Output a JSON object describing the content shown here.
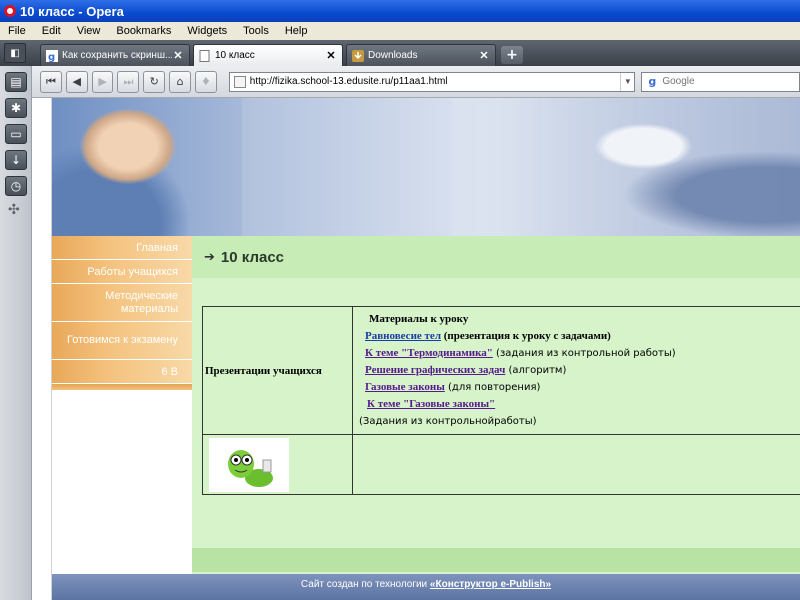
{
  "window": {
    "title": "10 класс - Opera"
  },
  "menu": {
    "items": [
      "File",
      "Edit",
      "View",
      "Bookmarks",
      "Widgets",
      "Tools",
      "Help"
    ]
  },
  "tabs": [
    {
      "label": "Как сохранить скринш...",
      "active": false
    },
    {
      "label": "10 класс",
      "active": true
    },
    {
      "label": "Downloads",
      "active": false
    }
  ],
  "address": {
    "url": "http://fizika.school-13.edusite.ru/p11aa1.html"
  },
  "search": {
    "placeholder": "Google"
  },
  "sitenav": {
    "items": [
      "Главная",
      "Работы учащихся",
      "Методические материалы",
      "Готовимся к экзамену",
      "6 В"
    ]
  },
  "page": {
    "heading": "10 класс",
    "row_label": "Презентации учащихся",
    "materials_header": "Материалы к уроку",
    "links": [
      {
        "text": "Равновесие тел",
        "note": " (презентация к уроку с задачами)"
      },
      {
        "text": "К теме \"Термодинамика\"",
        "note": " (задания из контрольной работы)"
      },
      {
        "text": "Решение графических задач",
        "note": " (алгоритм)"
      },
      {
        "text": "Газовые законы",
        "note": " (для повторения)"
      },
      {
        "text": "К теме \"Газовые законы\"",
        "note": ""
      }
    ],
    "last_note": "(Задания  из контрольнойработы)"
  },
  "footer": {
    "prefix": "Сайт создан по технологии ",
    "link": "«Конструктор e-Publish»"
  },
  "colors": {
    "title_bar": "#0a4bd0",
    "nav_orange": "#f4c27e",
    "content_green": "#d6f3c9",
    "footer_blue": "#5c74a3"
  },
  "icons": [
    "opera-logo-icon",
    "back-icon",
    "forward-icon",
    "reload-icon",
    "home-icon",
    "wand-icon",
    "google-icon",
    "mascot-image"
  ]
}
